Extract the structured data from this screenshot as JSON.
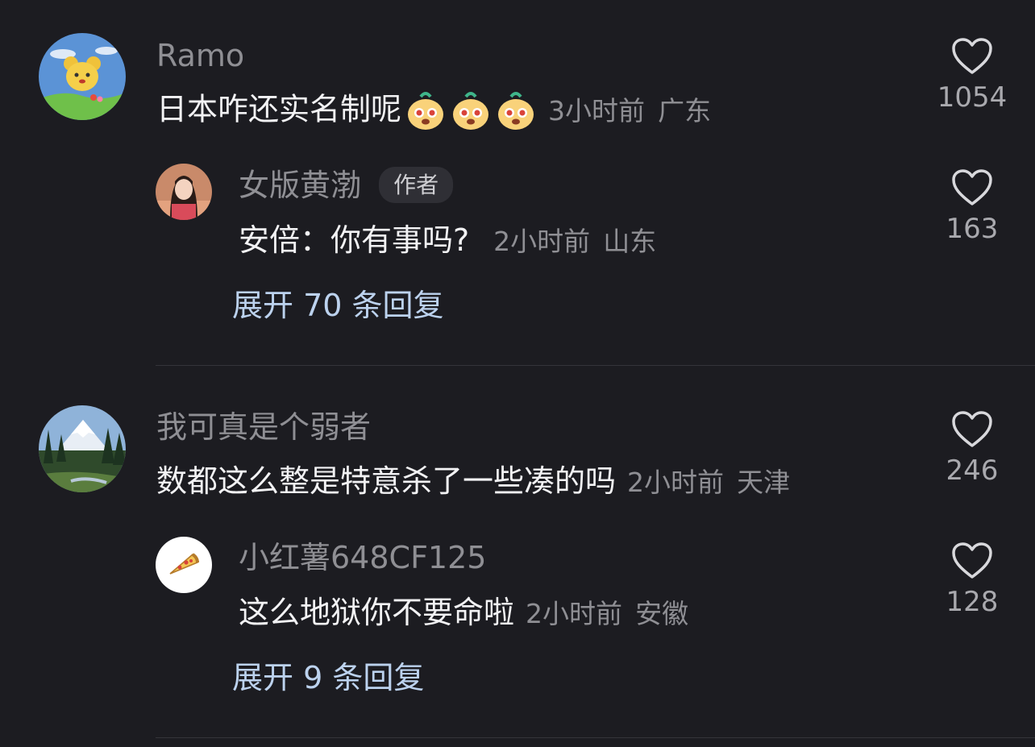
{
  "comments": [
    {
      "username": "Ramo",
      "text": "日本咋还实名制呢",
      "time": "3小时前",
      "location": "广东",
      "likes": "1054",
      "emoji_count": 3,
      "reply": {
        "username": "女版黄渤",
        "badge": "作者",
        "text": "安倍：你有事吗?",
        "time": "2小时前",
        "location": "山东",
        "likes": "163"
      },
      "expand_label": "展开 70 条回复"
    },
    {
      "username": "我可真是个弱者",
      "text": "数都这么整是特意杀了一些凑的吗",
      "time": "2小时前",
      "location": "天津",
      "likes": "246",
      "reply": {
        "username": "小红薯648CF125",
        "text": "这么地狱你不要命啦",
        "time": "2小时前",
        "location": "安徽",
        "likes": "128"
      },
      "expand_label": "展开 9 条回复"
    }
  ],
  "colors": {
    "background": "#1c1c21",
    "secondary_text": "#8f8f94",
    "link": "#bcd2ee"
  },
  "icons": [
    "heart-outline-icon",
    "pizza-icon",
    "cartoon-bear-avatar",
    "girl-avatar",
    "mountain-landscape-avatar",
    "puppy-emoji"
  ]
}
